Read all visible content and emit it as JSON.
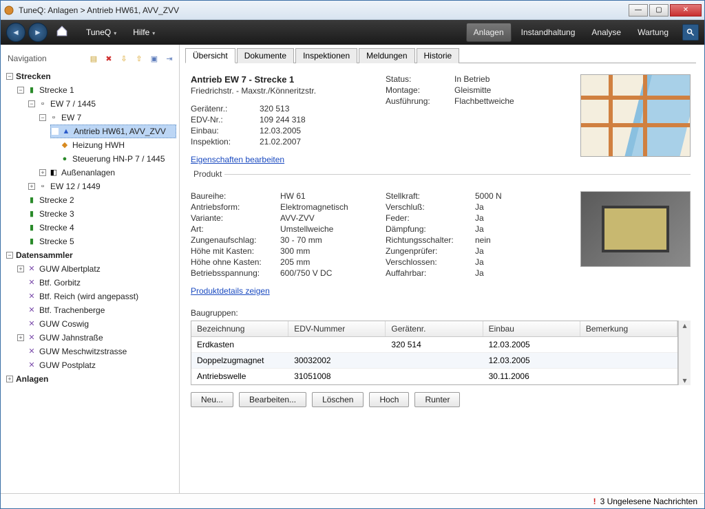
{
  "window": {
    "title": "TuneQ: Anlagen > Antrieb HW61, AVV_ZVV"
  },
  "toolbar": {
    "menus": [
      "TuneQ",
      "Hilfe"
    ],
    "main": [
      "Anlagen",
      "Instandhaltung",
      "Analyse",
      "Wartung"
    ],
    "active_main": 0
  },
  "sidebar": {
    "title": "Navigation",
    "groups": [
      {
        "label": "Strecken"
      },
      {
        "label": "Datensammler"
      },
      {
        "label": "Anlagen"
      }
    ],
    "strecken": [
      "Strecke 1",
      "Strecke 2",
      "Strecke 3",
      "Strecke 4",
      "Strecke 5"
    ],
    "s1": {
      "ew7_1445": "EW 7 / 1445",
      "ew7": "EW 7",
      "children": [
        "Antrieb HW61, AVV_ZVV",
        "Heizung HWH",
        "Steuerung HN-P 7 / 1445",
        "Außenanlagen"
      ],
      "ew12": "EW 12 / 1449"
    },
    "daten": [
      "GUW Albertplatz",
      "Btf. Gorbitz",
      "Btf. Reich (wird angepasst)",
      "Btf. Trachenberge",
      "GUW Coswig",
      "GUW Jahnstraße",
      "GUW Meschwitzstrasse",
      "GUW Postplatz"
    ]
  },
  "tabs": [
    "Übersicht",
    "Dokumente",
    "Inspektionen",
    "Meldungen",
    "Historie"
  ],
  "overview": {
    "title": "Antrieb EW 7 - Strecke 1",
    "subtitle": "Friedrichstr. - Maxstr./Könneritzstr.",
    "left": [
      {
        "k": "Gerätenr.:",
        "v": "320 513"
      },
      {
        "k": "EDV-Nr.:",
        "v": "109 244 318"
      },
      {
        "k": "Einbau:",
        "v": "12.03.2005"
      },
      {
        "k": "Inspektion:",
        "v": "21.02.2007"
      }
    ],
    "right": [
      {
        "k": "Status:",
        "v": "In Betrieb"
      },
      {
        "k": "Montage:",
        "v": "Gleismitte"
      },
      {
        "k": "Ausführung:",
        "v": "Flachbettweiche"
      }
    ],
    "edit_link": "Eigenschaften bearbeiten"
  },
  "product": {
    "label": "Produkt",
    "left": [
      {
        "k": "Baureihe:",
        "v": "HW 61"
      },
      {
        "k": "Antriebsform:",
        "v": "Elektromagnetisch"
      },
      {
        "k": "Variante:",
        "v": "AVV-ZVV"
      },
      {
        "k": "Art:",
        "v": "Umstellweiche"
      },
      {
        "k": "Zungenaufschlag:",
        "v": "30 - 70 mm"
      },
      {
        "k": "Höhe mit Kasten:",
        "v": "300 mm"
      },
      {
        "k": "Höhe ohne Kasten:",
        "v": "205 mm"
      },
      {
        "k": "Betriebsspannung:",
        "v": "600/750 V DC"
      }
    ],
    "right": [
      {
        "k": "Stellkraft:",
        "v": "5000 N"
      },
      {
        "k": "Verschluß:",
        "v": "Ja"
      },
      {
        "k": "Feder:",
        "v": "Ja"
      },
      {
        "k": "Dämpfung:",
        "v": "Ja"
      },
      {
        "k": "Richtungsschalter:",
        "v": "nein"
      },
      {
        "k": "Zungenprüfer:",
        "v": "Ja"
      },
      {
        "k": "Verschlossen:",
        "v": "Ja"
      },
      {
        "k": "Auffahrbar:",
        "v": "Ja"
      }
    ],
    "link": "Produktdetails zeigen"
  },
  "assemblies": {
    "label": "Baugruppen:",
    "cols": [
      "Bezeichnung",
      "EDV-Nummer",
      "Gerätenr.",
      "Einbau",
      "Bemerkung"
    ],
    "rows": [
      {
        "name": "Erdkasten",
        "edv": "",
        "ger": "320 514",
        "einbau": "12.03.2005",
        "bem": ""
      },
      {
        "name": "Doppelzugmagnet",
        "edv": "30032002",
        "ger": "",
        "einbau": "12.03.2005",
        "bem": ""
      },
      {
        "name": "Antriebswelle",
        "edv": "31051008",
        "ger": "",
        "einbau": "30.11.2006",
        "bem": ""
      }
    ],
    "buttons": [
      "Neu...",
      "Bearbeiten...",
      "Löschen",
      "Hoch",
      "Runter"
    ]
  },
  "status": {
    "unread": "3 Ungelesene Nachrichten"
  }
}
